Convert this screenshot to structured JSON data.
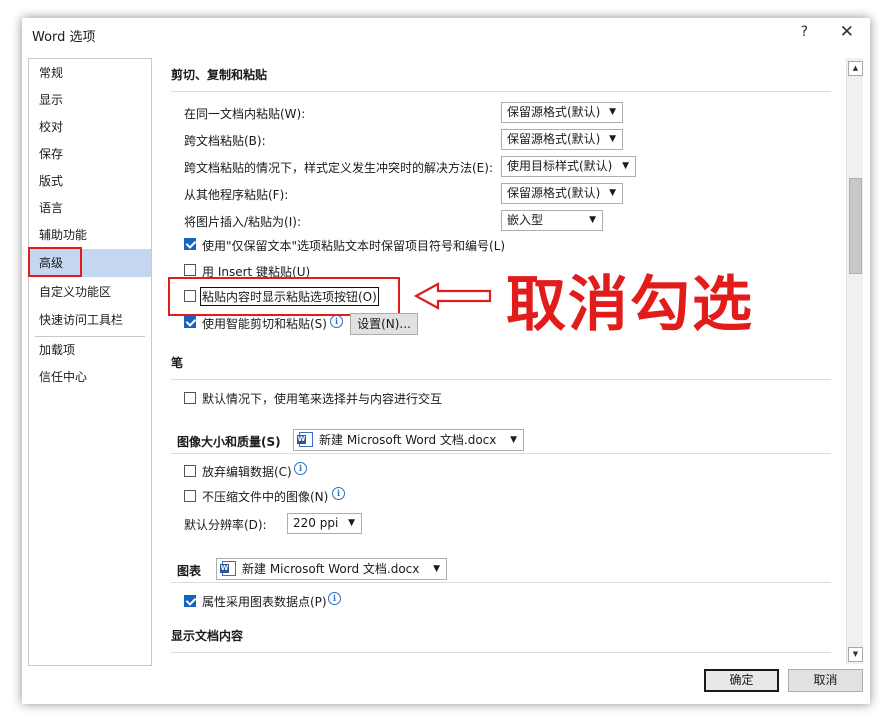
{
  "window": {
    "title": "Word 选项",
    "help": "?",
    "close": "✕"
  },
  "sidebar": {
    "items": [
      "常规",
      "显示",
      "校对",
      "保存",
      "版式",
      "语言",
      "辅助功能",
      "高级",
      "自定义功能区",
      "快速访问工具栏",
      "加载项",
      "信任中心"
    ],
    "selected": "高级"
  },
  "sections": {
    "cut_copy_paste": {
      "title": "剪切、复制和粘贴",
      "rows": [
        {
          "label": "在同一文档内粘贴(W):",
          "value": "保留源格式(默认)"
        },
        {
          "label": "跨文档粘贴(B):",
          "value": "保留源格式(默认)"
        },
        {
          "label": "跨文档粘贴的情况下，样式定义发生冲突时的解决方法(E):",
          "value": "使用目标样式(默认)"
        },
        {
          "label": "从其他程序粘贴(F):",
          "value": "保留源格式(默认)"
        },
        {
          "label": "将图片插入/粘贴为(I):",
          "value": "嵌入型"
        }
      ],
      "checks": [
        {
          "label": "使用\"仅保留文本\"选项粘贴文本时保留项目符号和编号(L)",
          "checked": true
        },
        {
          "label": "用 Insert 键粘贴(U)",
          "checked": false
        },
        {
          "label": "粘贴内容时显示粘贴选项按钮(O)",
          "checked": false
        },
        {
          "label": "使用智能剪切和粘贴(S)",
          "checked": true
        }
      ],
      "settings_button": "设置(N)..."
    },
    "pen": {
      "title": "笔",
      "check": {
        "label": "默认情况下，使用笔来选择并与内容进行交互",
        "checked": false
      }
    },
    "image": {
      "title": "图像大小和质量(S)",
      "doc": "新建 Microsoft Word 文档.docx",
      "checks": [
        {
          "label": "放弃编辑数据(C)",
          "checked": false
        },
        {
          "label": "不压缩文件中的图像(N)",
          "checked": false
        }
      ],
      "resolution_label": "默认分辨率(D):",
      "resolution_value": "220 ppi"
    },
    "chart": {
      "title": "图表",
      "doc": "新建 Microsoft Word 文档.docx",
      "check": {
        "label": "属性采用图表数据点(P)",
        "checked": true
      }
    },
    "display": {
      "title": "显示文档内容"
    }
  },
  "annotation": {
    "text": "取消勾选",
    "color": "#e21b1b"
  },
  "footer": {
    "ok": "确定",
    "cancel": "取消"
  },
  "icons": {
    "info": "i",
    "dropdown": "▼",
    "scroll_up": "▲",
    "scroll_down": "▼"
  }
}
